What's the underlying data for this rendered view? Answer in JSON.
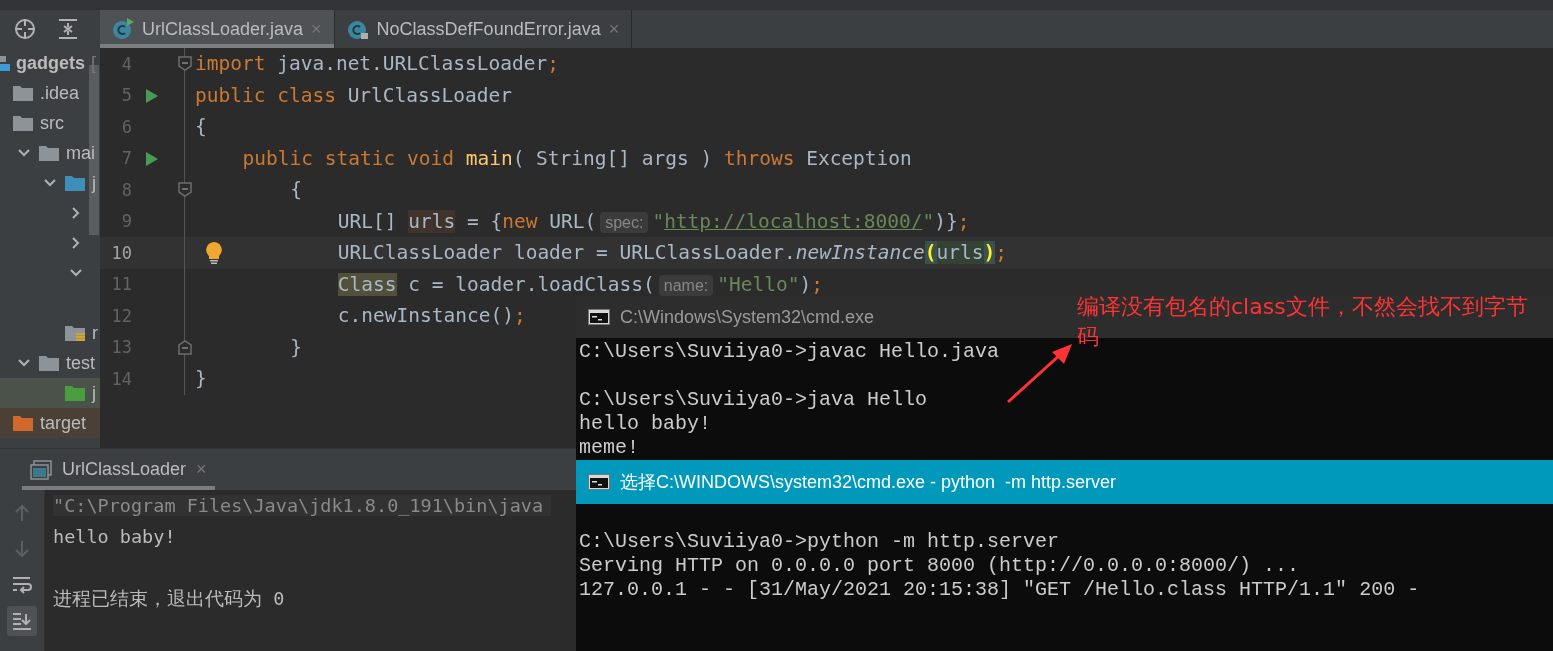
{
  "project_tree": {
    "items": [
      {
        "label": "gadgets",
        "suffix": "[",
        "kind": "module",
        "selected": false,
        "children": [
          {
            "label": ".idea",
            "kind": "folder",
            "selected": false
          },
          {
            "label": "src",
            "kind": "folder",
            "selected": false,
            "children": [
              {
                "label": "mai",
                "kind": "folder",
                "expanded": true,
                "selected": false,
                "children": [
                  {
                    "label": "j",
                    "kind": "source_folder",
                    "expanded": true,
                    "selected": false,
                    "children": [
                      {
                        "expanded": false,
                        "selected": false
                      },
                      {
                        "expanded": false,
                        "selected": false
                      },
                      {
                        "expanded": true,
                        "selected": false
                      }
                    ]
                  },
                  {
                    "label": "r",
                    "kind": "resources_folder",
                    "selected": false
                  }
                ]
              },
              {
                "label": "test",
                "kind": "folder",
                "expanded": true,
                "selected": false,
                "children": [
                  {
                    "label": "j",
                    "kind": "test_folder",
                    "selected": true
                  }
                ]
              }
            ]
          },
          {
            "label": "target",
            "kind": "excluded_folder",
            "selected": false
          }
        ]
      }
    ]
  },
  "editor_tabs": [
    {
      "label": "UrlClassLoader.java",
      "close": "×",
      "selected": true,
      "locked": false
    },
    {
      "label": "NoClassDefFoundError.java",
      "close": "×",
      "selected": false,
      "locked": true
    }
  ],
  "code_lines": [
    {
      "number": "4",
      "kind": "fold_start",
      "current": false,
      "tokens": [
        {
          "kind": "keyword",
          "text": "import"
        },
        {
          "kind": "plain",
          "text": " java.net.URLClassLoader"
        },
        {
          "kind": "semi",
          "text": ";"
        }
      ]
    },
    {
      "number": "5",
      "kind": "run",
      "current": false,
      "tokens": [
        {
          "kind": "keyword",
          "text": "public class"
        },
        {
          "kind": "plain",
          "text": " UrlClassLoader"
        }
      ]
    },
    {
      "number": "6",
      "kind": "plain",
      "current": false,
      "tokens": [
        {
          "kind": "plain",
          "text": "{"
        }
      ],
      "children": [
        {
          "number": "7",
          "kind": "run",
          "current": false,
          "tokens": [
            {
              "kind": "keyword",
              "text": "public static void"
            },
            {
              "kind": "method",
              "text": " main"
            },
            {
              "kind": "plain",
              "text": "( String[] args ) "
            },
            {
              "kind": "keyword",
              "text": "throws"
            },
            {
              "kind": "plain",
              "text": " Exception"
            }
          ],
          "children": [
            {
              "number": "8",
              "kind": "fold_start",
              "current": false,
              "tokens": [
                {
                  "kind": "plain",
                  "text": "{"
                }
              ],
              "children": [
                {
                  "number": "9",
                  "kind": "plain",
                  "current": false,
                  "tokens": [
                    {
                      "kind": "plain",
                      "text": "URL[] "
                    },
                    {
                      "kind": "write_usage",
                      "text": "urls"
                    },
                    {
                      "kind": "plain",
                      "text": " = {"
                    },
                    {
                      "kind": "keyword",
                      "text": "new"
                    },
                    {
                      "kind": "plain",
                      "text": " URL("
                    },
                    {
                      "kind": "hint",
                      "text": "spec:"
                    },
                    {
                      "kind": "string",
                      "text": "\""
                    },
                    {
                      "kind": "url",
                      "text": "http://localhost:8000/"
                    },
                    {
                      "kind": "string",
                      "text": "\""
                    },
                    {
                      "kind": "plain",
                      "text": ")}"
                    },
                    {
                      "kind": "semi",
                      "text": ";"
                    }
                  ]
                },
                {
                  "number": "10",
                  "kind": "bulb",
                  "current": true,
                  "tokens": [
                    {
                      "kind": "plain",
                      "text": "URLClassLoader loader = URLClassLoader."
                    },
                    {
                      "kind": "italic",
                      "text": "newInstance"
                    },
                    {
                      "kind": "match",
                      "text": "("
                    },
                    {
                      "kind": "match_text",
                      "text": "urls"
                    },
                    {
                      "kind": "match",
                      "text": ")"
                    },
                    {
                      "kind": "semi",
                      "text": ";"
                    }
                  ]
                },
                {
                  "number": "11",
                  "kind": "plain",
                  "current": false,
                  "tokens": [
                    {
                      "kind": "usage",
                      "text": "Class"
                    },
                    {
                      "kind": "plain",
                      "text": " c = loader.loadClass("
                    },
                    {
                      "kind": "hint",
                      "text": "name:"
                    },
                    {
                      "kind": "string",
                      "text": "\"Hello\""
                    },
                    {
                      "kind": "plain",
                      "text": ")"
                    },
                    {
                      "kind": "semi",
                      "text": ";"
                    }
                  ]
                },
                {
                  "number": "12",
                  "kind": "plain",
                  "current": false,
                  "tokens": [
                    {
                      "kind": "plain",
                      "text": "c.newInstance()"
                    },
                    {
                      "kind": "semi",
                      "text": ";"
                    }
                  ]
                }
              ]
            },
            {
              "number": "13",
              "kind": "fold_end",
              "current": false,
              "tokens": [
                {
                  "kind": "plain",
                  "text": "}"
                }
              ]
            }
          ]
        }
      ]
    },
    {
      "number": "14",
      "kind": "plain",
      "current": false,
      "tokens": [
        {
          "kind": "plain",
          "text": "}"
        }
      ]
    }
  ],
  "run_panel": {
    "tab": {
      "label": "UrlClassLoader",
      "close": "×",
      "selected": true
    },
    "tools": [
      {
        "kind": "up",
        "disabled": true,
        "selected": false
      },
      {
        "kind": "down",
        "disabled": true,
        "selected": false
      },
      {
        "kind": "wrap",
        "disabled": false,
        "selected": false
      },
      {
        "kind": "scroll_end",
        "disabled": false,
        "selected": true
      }
    ],
    "command": "\"C:\\Program Files\\Java\\jdk1.8.0_191\\bin\\java",
    "blocks": [
      [
        "hello baby!"
      ],
      [
        "进程已结束，退出代码为 0"
      ]
    ]
  },
  "console_windows": [
    {
      "title": "C:\\Windows\\System32\\cmd.exe",
      "active": false,
      "blocks": [
        [
          "C:\\Users\\Suviiya0->javac Hello.java"
        ],
        [
          "C:\\Users\\Suviiya0->java Hello",
          "hello baby!",
          "meme!"
        ]
      ]
    },
    {
      "title": "选择C:\\WINDOWS\\system32\\cmd.exe - python  -m http.server",
      "active": true,
      "blocks": [
        [
          "C:\\Users\\Suviiya0->python -m http.server",
          "Serving HTTP on 0.0.0.0 port 8000 (http://0.0.0.0:8000/) ...",
          "127.0.0.1 - - [31/May/2021 20:15:38] ″GET /Hello.class HTTP/1.1″ 200 -"
        ]
      ]
    }
  ],
  "annotation": {
    "text": "编译没有包名的class文件，不然会找不到字节码",
    "color": "#ff3333"
  }
}
